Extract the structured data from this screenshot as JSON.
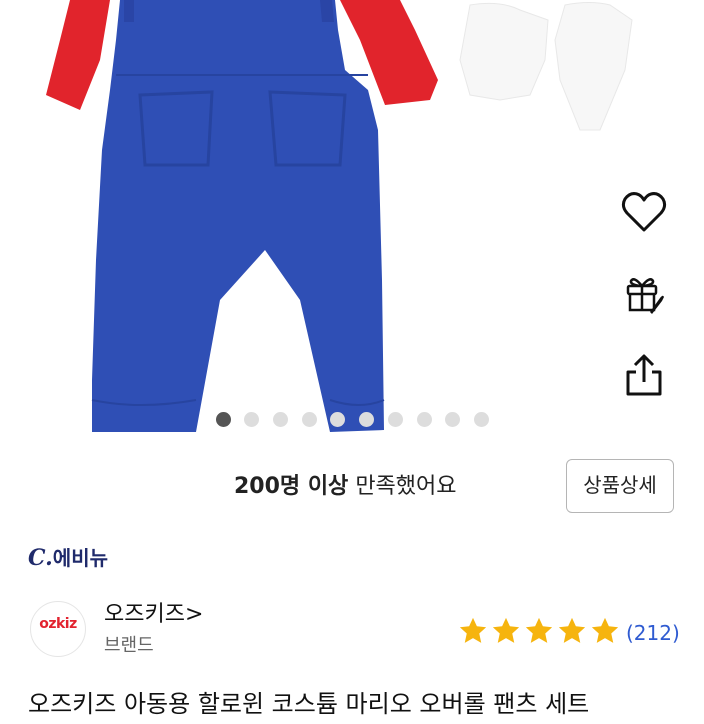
{
  "carousel": {
    "total_slides": 10,
    "active_index": 0
  },
  "actions": {
    "favorite_icon": "heart-icon",
    "gift_icon": "gift-icon",
    "share_icon": "share-icon"
  },
  "satisfaction": {
    "count_text": "200명 이상",
    "suffix_text": "만족했어요"
  },
  "detail_button": {
    "label": "상품상세"
  },
  "seller": {
    "logo_mark": "C.",
    "logo_name": "에비뉴"
  },
  "brand": {
    "avatar_text": "ozkiz",
    "name": "오즈키즈",
    "arrow": ">",
    "sub_label": "브랜드"
  },
  "rating": {
    "stars": 5,
    "max_stars": 5,
    "review_count": "(212)"
  },
  "product": {
    "title": "오즈키즈 아동용 할로윈 코스튬 마리오 오버롤 팬츠 세트"
  },
  "colors": {
    "overall_blue": "#2f4fb5",
    "shirt_red": "#e1242c",
    "star_gold": "#f6b40e",
    "link_blue": "#2f5bd1"
  }
}
